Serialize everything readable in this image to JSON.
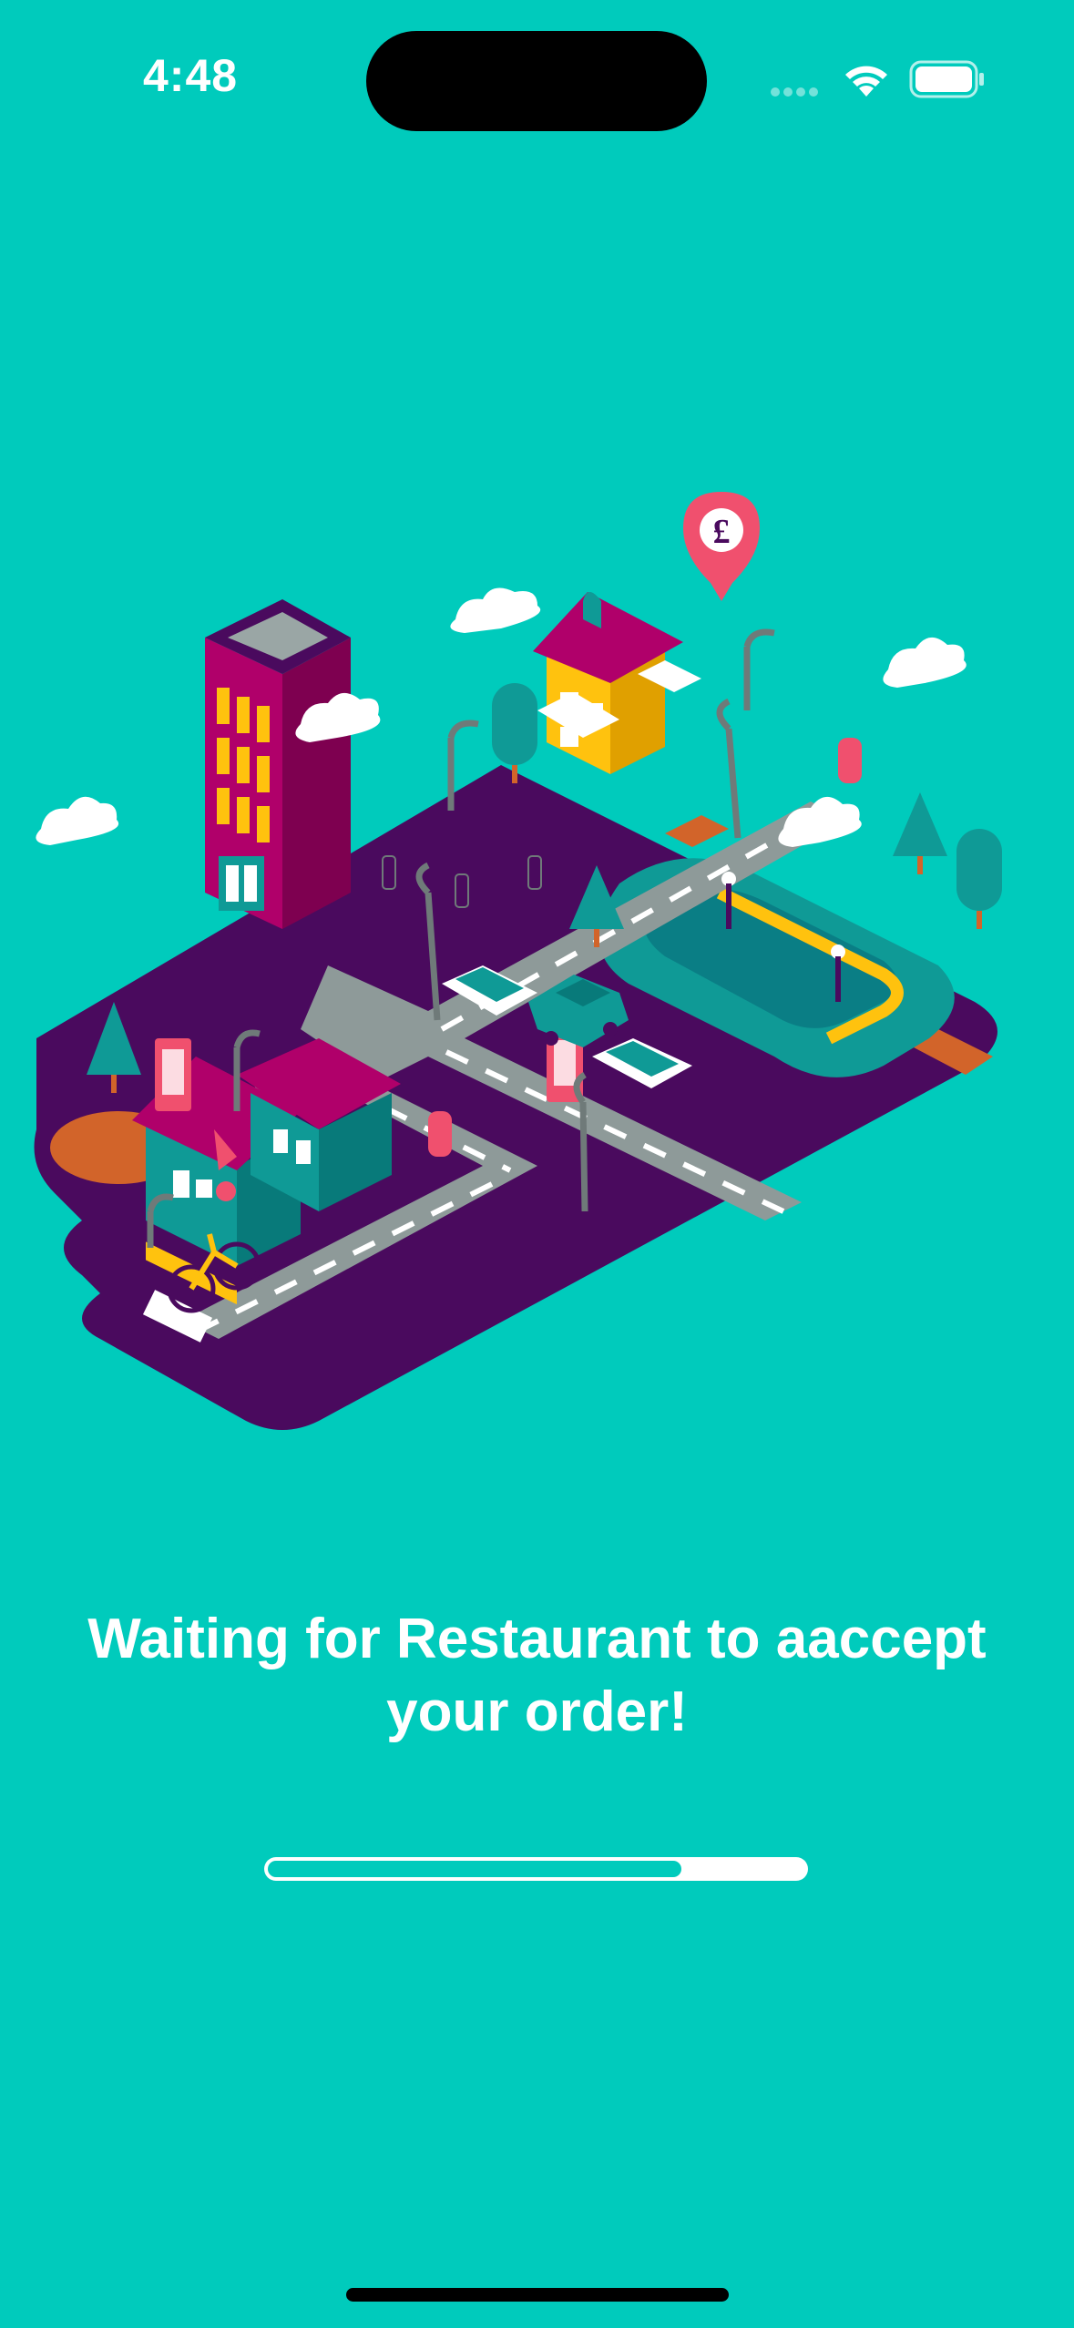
{
  "status_bar": {
    "time": "4:48",
    "icons": [
      "signal-icon",
      "wifi-icon",
      "battery-icon"
    ]
  },
  "illustration": {
    "icon": "isometric-city-delivery-illustration",
    "pin_symbol": "£"
  },
  "message": {
    "line1": "Waiting for Restaurant to aaccept",
    "line2": "your order!"
  },
  "progress": {
    "value_fraction": 0.77
  },
  "colors": {
    "background": "#00CBBC",
    "road_base": "#4A0A5E",
    "road": "#8E9A99",
    "building_magenta": "#B0006A",
    "accent_yellow": "#FFC20E",
    "pin_red": "#F0506E"
  }
}
